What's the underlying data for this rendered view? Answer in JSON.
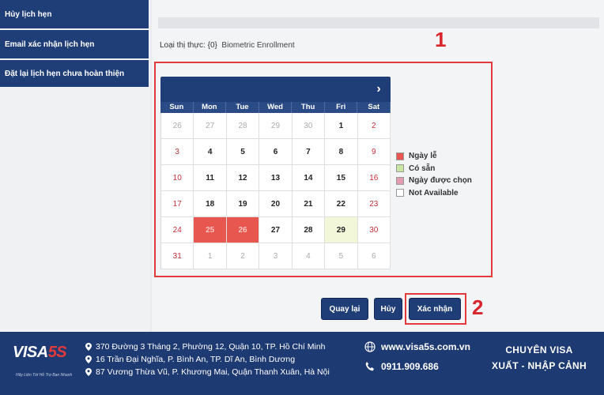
{
  "sidebar": {
    "items": [
      {
        "label": "Hủy lịch hẹn"
      },
      {
        "label": "Email xác nhận lịch hẹn"
      },
      {
        "label": "Đặt lại lịch hẹn chưa hoàn thiện"
      }
    ]
  },
  "main": {
    "visa_type_label": "Loại thị thực: {0}",
    "visa_type_value": "Biometric Enrollment",
    "step1": "1",
    "step2": "2"
  },
  "calendar": {
    "next_glyph": "›",
    "weekdays": [
      "Sun",
      "Mon",
      "Tue",
      "Wed",
      "Thu",
      "Fri",
      "Sat"
    ],
    "weeks": [
      [
        {
          "d": "26",
          "s": "other"
        },
        {
          "d": "27",
          "s": "other"
        },
        {
          "d": "28",
          "s": "other"
        },
        {
          "d": "29",
          "s": "other"
        },
        {
          "d": "30",
          "s": "other"
        },
        {
          "d": "1",
          "s": ""
        },
        {
          "d": "2",
          "s": "wk"
        }
      ],
      [
        {
          "d": "3",
          "s": "wk"
        },
        {
          "d": "4",
          "s": ""
        },
        {
          "d": "5",
          "s": ""
        },
        {
          "d": "6",
          "s": ""
        },
        {
          "d": "7",
          "s": ""
        },
        {
          "d": "8",
          "s": ""
        },
        {
          "d": "9",
          "s": "wk"
        }
      ],
      [
        {
          "d": "10",
          "s": "wk"
        },
        {
          "d": "11",
          "s": ""
        },
        {
          "d": "12",
          "s": ""
        },
        {
          "d": "13",
          "s": ""
        },
        {
          "d": "14",
          "s": ""
        },
        {
          "d": "15",
          "s": ""
        },
        {
          "d": "16",
          "s": "wk"
        }
      ],
      [
        {
          "d": "17",
          "s": "wk"
        },
        {
          "d": "18",
          "s": ""
        },
        {
          "d": "19",
          "s": ""
        },
        {
          "d": "20",
          "s": ""
        },
        {
          "d": "21",
          "s": ""
        },
        {
          "d": "22",
          "s": ""
        },
        {
          "d": "23",
          "s": "wk"
        }
      ],
      [
        {
          "d": "24",
          "s": "wk"
        },
        {
          "d": "25",
          "s": "holiday"
        },
        {
          "d": "26",
          "s": "holiday"
        },
        {
          "d": "27",
          "s": ""
        },
        {
          "d": "28",
          "s": ""
        },
        {
          "d": "29",
          "s": "avail"
        },
        {
          "d": "30",
          "s": "wk"
        }
      ],
      [
        {
          "d": "31",
          "s": "wk"
        },
        {
          "d": "1",
          "s": "other"
        },
        {
          "d": "2",
          "s": "other"
        },
        {
          "d": "3",
          "s": "other"
        },
        {
          "d": "4",
          "s": "other"
        },
        {
          "d": "5",
          "s": "other"
        },
        {
          "d": "6",
          "s": "other"
        }
      ]
    ]
  },
  "legend": {
    "items": [
      {
        "label": "Ngày lễ",
        "color": "#e85650"
      },
      {
        "label": "Có sẵn",
        "color": "#c9e6a3"
      },
      {
        "label": "Ngày được chọn",
        "color": "#e39bb0"
      },
      {
        "label": "Not Available",
        "color": "#ffffff"
      }
    ]
  },
  "buttons": {
    "back": "Quay lại",
    "cancel": "Hủy",
    "confirm": "Xác nhận"
  },
  "footer": {
    "logo_main": "VISA",
    "logo_accent": "5S",
    "logo_slogan": "Hãy Liên Tới Hỗ Trợ Bạn Nhanh",
    "addresses": [
      "370 Đường 3 Tháng 2, Phường 12, Quận 10, TP. Hồ Chí Minh",
      "16 Trần Đại Nghĩa, P. Bình An, TP. Dĩ An, Bình Dương",
      "87 Vương Thừa Vũ, P. Khương Mai, Quận Thanh Xuân, Hà Nội"
    ],
    "website": "www.visa5s.com.vn",
    "phone": "0911.909.686",
    "tagline_1": "CHUYÊN VISA",
    "tagline_2": "XUẤT - NHẬP CẢNH"
  },
  "colors": {
    "primary": "#1f3e78",
    "highlight": "#e23a3a"
  }
}
